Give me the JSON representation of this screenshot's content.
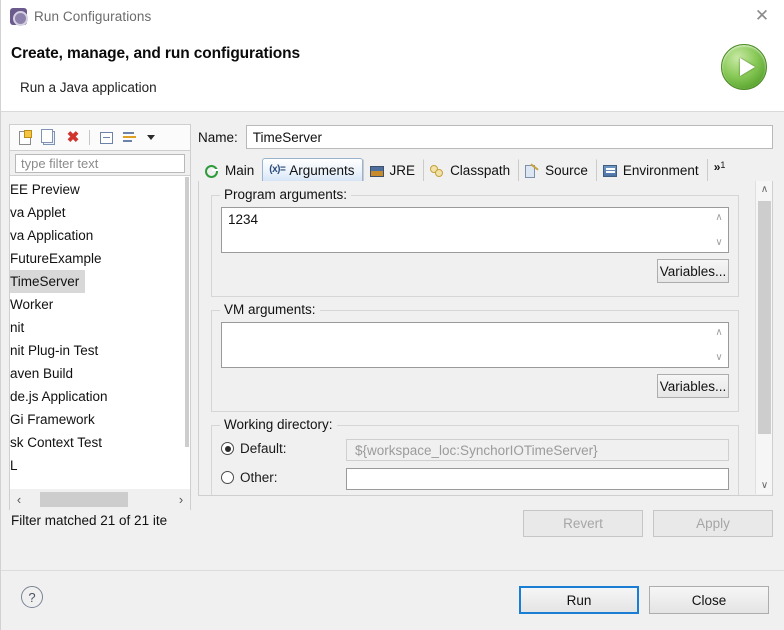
{
  "window": {
    "title": "Run Configurations",
    "icon": "run-configurations-icon",
    "close_label": "✕"
  },
  "header": {
    "title": "Create, manage, and run configurations",
    "subtitle": "Run a Java application",
    "icon": "green-run-play-icon"
  },
  "left_panel": {
    "toolbar": [
      {
        "name": "new-configuration-icon",
        "tooltip": "New launch configuration"
      },
      {
        "name": "duplicate-configuration-icon",
        "tooltip": "Duplicate"
      },
      {
        "name": "delete-configuration-icon",
        "tooltip": "Delete",
        "glyph": "✖"
      },
      {
        "name": "collapse-all-icon",
        "tooltip": "Collapse All"
      },
      {
        "name": "filter-configurations-icon",
        "tooltip": "Filter"
      },
      {
        "name": "view-menu-arrow-icon",
        "tooltip": "View Menu"
      }
    ],
    "filter": {
      "placeholder": "type filter text",
      "value": ""
    },
    "items": [
      {
        "label": "EE Preview",
        "selected": false
      },
      {
        "label": "va Applet",
        "selected": false
      },
      {
        "label": "va Application",
        "selected": false
      },
      {
        "label": "FutureExample",
        "selected": false
      },
      {
        "label": "TimeServer",
        "selected": true
      },
      {
        "label": "Worker",
        "selected": false
      },
      {
        "label": "nit",
        "selected": false
      },
      {
        "label": "nit Plug-in Test",
        "selected": false
      },
      {
        "label": "aven Build",
        "selected": false
      },
      {
        "label": "de.js Application",
        "selected": false
      },
      {
        "label": "Gi Framework",
        "selected": false
      },
      {
        "label": "sk Context Test",
        "selected": false
      },
      {
        "label": "L",
        "selected": false
      }
    ],
    "hscroll": {
      "left_arrow": "‹",
      "right_arrow": "›"
    },
    "status": "Filter matched 21 of 21 ite"
  },
  "right_panel": {
    "name_label": "Name:",
    "name_value": "TimeServer",
    "tabs": [
      {
        "label": "Main",
        "icon": "main-tab-icon",
        "active": false
      },
      {
        "label": "Arguments",
        "icon": "arguments-tab-icon",
        "active": true
      },
      {
        "label": "JRE",
        "icon": "jre-tab-icon",
        "active": false
      },
      {
        "label": "Classpath",
        "icon": "classpath-tab-icon",
        "active": false
      },
      {
        "label": "Source",
        "icon": "source-tab-icon",
        "active": false
      },
      {
        "label": "Environment",
        "icon": "environment-tab-icon",
        "active": false
      }
    ],
    "tab_overflow": {
      "label": "»",
      "count": "1"
    },
    "program_arguments": {
      "title": "Program arguments:",
      "value": "1234",
      "variables_button": "Variables...",
      "spinner_up": "∧",
      "spinner_down": "∨"
    },
    "vm_arguments": {
      "title": "VM arguments:",
      "value": "",
      "variables_button": "Variables...",
      "spinner_up": "∧",
      "spinner_down": "∨"
    },
    "working_directory": {
      "title": "Working directory:",
      "default_label": "Default:",
      "default_selected": true,
      "default_path": "${workspace_loc:SynchorIOTimeServer}",
      "other_label": "Other:",
      "other_selected": false,
      "other_path": ""
    },
    "scrollbar": {
      "up_arrow": "∧",
      "down_arrow": "∨"
    }
  },
  "actions": {
    "revert": {
      "label": "Revert",
      "enabled": false
    },
    "apply": {
      "label": "Apply",
      "enabled": false
    },
    "run": {
      "label": "Run",
      "focused": true
    },
    "close": {
      "label": "Close",
      "focused": false
    },
    "help": {
      "label": "?"
    }
  },
  "colors": {
    "accent_blue": "#1a7fd4",
    "selection_gray": "#d8d8d8",
    "dialog_bg": "#f0f0f0",
    "run_green": "#5ea832",
    "delete_red": "#d0342c"
  }
}
